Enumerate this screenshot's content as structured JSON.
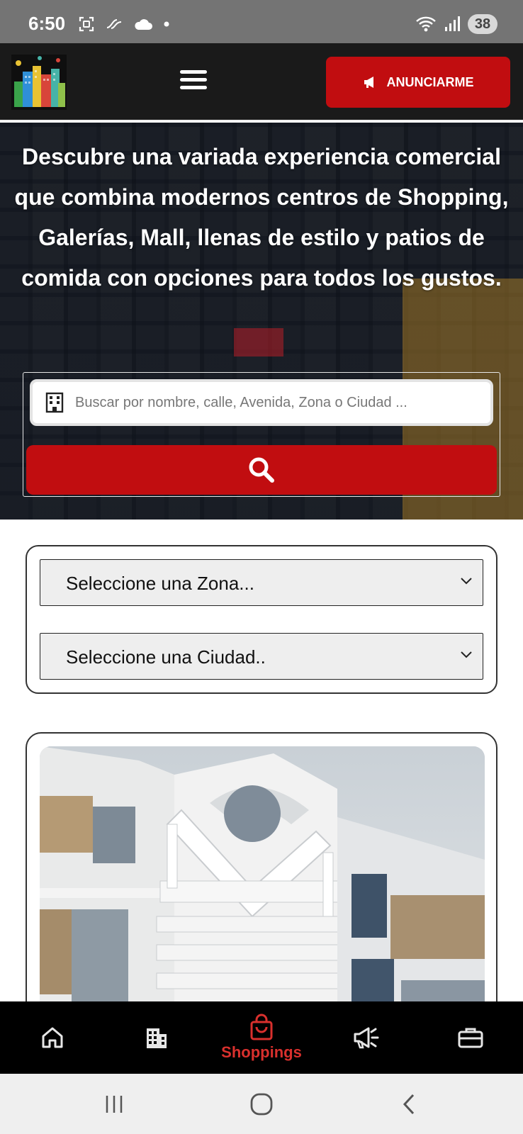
{
  "status_bar": {
    "time": "6:50",
    "battery": "38",
    "icons": [
      "screenshot-icon",
      "link-icon",
      "cloud-icon",
      "dot-icon",
      "wifi-icon",
      "signal-icon"
    ]
  },
  "header": {
    "advertise_label": "ANUNCIARME",
    "icons": [
      "logo-icon",
      "hamburger-menu-icon",
      "megaphone-icon"
    ]
  },
  "hero": {
    "title": "Descubre una variada experiencia comercial que combina modernos centros de Shopping, Galerías, Mall, llenas de estilo y patios de comida con opciones para todos los gustos.",
    "search_placeholder": "Buscar por nombre, calle, Avenida, Zona o Ciudad ...",
    "search_value": ""
  },
  "filters": {
    "zona_selected": "Seleccione una Zona...",
    "ciudad_selected": "Seleccione una Ciudad.."
  },
  "bottom_nav": {
    "items": [
      {
        "icon": "home-icon",
        "label": ""
      },
      {
        "icon": "building-icon",
        "label": ""
      },
      {
        "icon": "shopping-bag-icon",
        "label": "Shoppings",
        "active": true
      },
      {
        "icon": "megaphone-icon",
        "label": ""
      },
      {
        "icon": "briefcase-icon",
        "label": ""
      }
    ]
  },
  "colors": {
    "brand_red": "#c10d10",
    "active_nav": "#d9302d",
    "header_bg": "#1a1a1a"
  }
}
